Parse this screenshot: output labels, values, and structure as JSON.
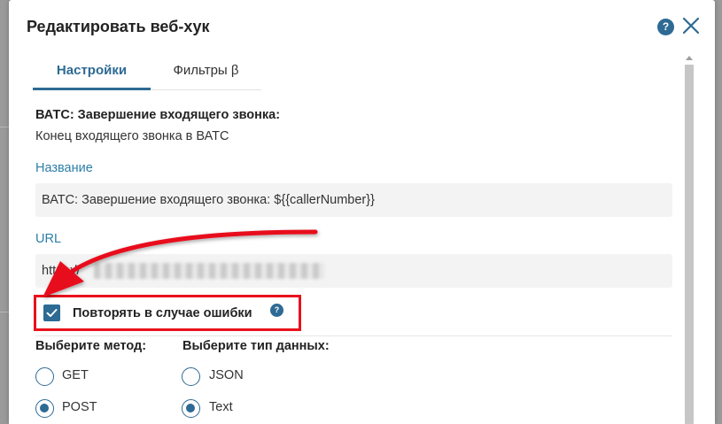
{
  "modal": {
    "title": "Редактировать веб-хук",
    "help_glyph": "?"
  },
  "tabs": [
    {
      "label": "Настройки",
      "active": true
    },
    {
      "label": "Фильтры β",
      "active": false
    }
  ],
  "event": {
    "title": "ВАТС: Завершение входящего звонка:",
    "description": "Конец входящего звонка в ВАТС"
  },
  "fields": {
    "name": {
      "label": "Название",
      "value": "ВАТС: Завершение входящего звонка: ${{callerNumber}}"
    },
    "url": {
      "label": "URL",
      "value": "https://"
    }
  },
  "retry": {
    "label": "Повторять в случае ошибки",
    "checked": true,
    "help_glyph": "?"
  },
  "method": {
    "label": "Выберите метод:",
    "options": [
      {
        "label": "GET",
        "checked": false
      },
      {
        "label": "POST",
        "checked": true
      }
    ]
  },
  "data_type": {
    "label": "Выберите тип данных:",
    "options": [
      {
        "label": "JSON",
        "checked": false
      },
      {
        "label": "Text",
        "checked": true
      }
    ]
  },
  "colors": {
    "accent": "#2d6a94",
    "label_blue": "#2d7ea7",
    "highlight_red": "#e8111c"
  }
}
